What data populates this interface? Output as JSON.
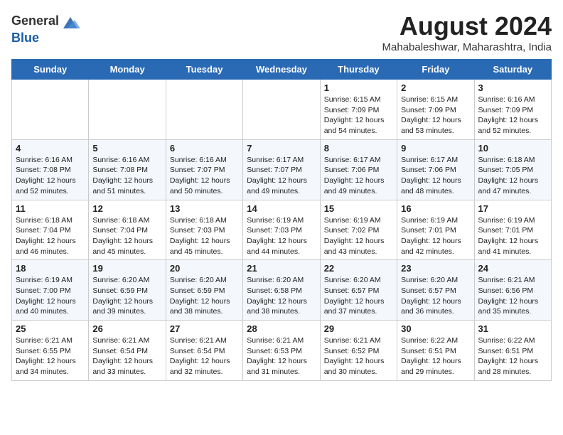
{
  "header": {
    "logo_general": "General",
    "logo_blue": "Blue",
    "month_year": "August 2024",
    "location": "Mahabaleshwar, Maharashtra, India"
  },
  "days_of_week": [
    "Sunday",
    "Monday",
    "Tuesday",
    "Wednesday",
    "Thursday",
    "Friday",
    "Saturday"
  ],
  "weeks": [
    [
      {
        "day": "",
        "sunrise": "",
        "sunset": "",
        "daylight": ""
      },
      {
        "day": "",
        "sunrise": "",
        "sunset": "",
        "daylight": ""
      },
      {
        "day": "",
        "sunrise": "",
        "sunset": "",
        "daylight": ""
      },
      {
        "day": "",
        "sunrise": "",
        "sunset": "",
        "daylight": ""
      },
      {
        "day": "1",
        "sunrise": "Sunrise: 6:15 AM",
        "sunset": "Sunset: 7:09 PM",
        "daylight": "Daylight: 12 hours and 54 minutes."
      },
      {
        "day": "2",
        "sunrise": "Sunrise: 6:15 AM",
        "sunset": "Sunset: 7:09 PM",
        "daylight": "Daylight: 12 hours and 53 minutes."
      },
      {
        "day": "3",
        "sunrise": "Sunrise: 6:16 AM",
        "sunset": "Sunset: 7:09 PM",
        "daylight": "Daylight: 12 hours and 52 minutes."
      }
    ],
    [
      {
        "day": "4",
        "sunrise": "Sunrise: 6:16 AM",
        "sunset": "Sunset: 7:08 PM",
        "daylight": "Daylight: 12 hours and 52 minutes."
      },
      {
        "day": "5",
        "sunrise": "Sunrise: 6:16 AM",
        "sunset": "Sunset: 7:08 PM",
        "daylight": "Daylight: 12 hours and 51 minutes."
      },
      {
        "day": "6",
        "sunrise": "Sunrise: 6:16 AM",
        "sunset": "Sunset: 7:07 PM",
        "daylight": "Daylight: 12 hours and 50 minutes."
      },
      {
        "day": "7",
        "sunrise": "Sunrise: 6:17 AM",
        "sunset": "Sunset: 7:07 PM",
        "daylight": "Daylight: 12 hours and 49 minutes."
      },
      {
        "day": "8",
        "sunrise": "Sunrise: 6:17 AM",
        "sunset": "Sunset: 7:06 PM",
        "daylight": "Daylight: 12 hours and 49 minutes."
      },
      {
        "day": "9",
        "sunrise": "Sunrise: 6:17 AM",
        "sunset": "Sunset: 7:06 PM",
        "daylight": "Daylight: 12 hours and 48 minutes."
      },
      {
        "day": "10",
        "sunrise": "Sunrise: 6:18 AM",
        "sunset": "Sunset: 7:05 PM",
        "daylight": "Daylight: 12 hours and 47 minutes."
      }
    ],
    [
      {
        "day": "11",
        "sunrise": "Sunrise: 6:18 AM",
        "sunset": "Sunset: 7:04 PM",
        "daylight": "Daylight: 12 hours and 46 minutes."
      },
      {
        "day": "12",
        "sunrise": "Sunrise: 6:18 AM",
        "sunset": "Sunset: 7:04 PM",
        "daylight": "Daylight: 12 hours and 45 minutes."
      },
      {
        "day": "13",
        "sunrise": "Sunrise: 6:18 AM",
        "sunset": "Sunset: 7:03 PM",
        "daylight": "Daylight: 12 hours and 45 minutes."
      },
      {
        "day": "14",
        "sunrise": "Sunrise: 6:19 AM",
        "sunset": "Sunset: 7:03 PM",
        "daylight": "Daylight: 12 hours and 44 minutes."
      },
      {
        "day": "15",
        "sunrise": "Sunrise: 6:19 AM",
        "sunset": "Sunset: 7:02 PM",
        "daylight": "Daylight: 12 hours and 43 minutes."
      },
      {
        "day": "16",
        "sunrise": "Sunrise: 6:19 AM",
        "sunset": "Sunset: 7:01 PM",
        "daylight": "Daylight: 12 hours and 42 minutes."
      },
      {
        "day": "17",
        "sunrise": "Sunrise: 6:19 AM",
        "sunset": "Sunset: 7:01 PM",
        "daylight": "Daylight: 12 hours and 41 minutes."
      }
    ],
    [
      {
        "day": "18",
        "sunrise": "Sunrise: 6:19 AM",
        "sunset": "Sunset: 7:00 PM",
        "daylight": "Daylight: 12 hours and 40 minutes."
      },
      {
        "day": "19",
        "sunrise": "Sunrise: 6:20 AM",
        "sunset": "Sunset: 6:59 PM",
        "daylight": "Daylight: 12 hours and 39 minutes."
      },
      {
        "day": "20",
        "sunrise": "Sunrise: 6:20 AM",
        "sunset": "Sunset: 6:59 PM",
        "daylight": "Daylight: 12 hours and 38 minutes."
      },
      {
        "day": "21",
        "sunrise": "Sunrise: 6:20 AM",
        "sunset": "Sunset: 6:58 PM",
        "daylight": "Daylight: 12 hours and 38 minutes."
      },
      {
        "day": "22",
        "sunrise": "Sunrise: 6:20 AM",
        "sunset": "Sunset: 6:57 PM",
        "daylight": "Daylight: 12 hours and 37 minutes."
      },
      {
        "day": "23",
        "sunrise": "Sunrise: 6:20 AM",
        "sunset": "Sunset: 6:57 PM",
        "daylight": "Daylight: 12 hours and 36 minutes."
      },
      {
        "day": "24",
        "sunrise": "Sunrise: 6:21 AM",
        "sunset": "Sunset: 6:56 PM",
        "daylight": "Daylight: 12 hours and 35 minutes."
      }
    ],
    [
      {
        "day": "25",
        "sunrise": "Sunrise: 6:21 AM",
        "sunset": "Sunset: 6:55 PM",
        "daylight": "Daylight: 12 hours and 34 minutes."
      },
      {
        "day": "26",
        "sunrise": "Sunrise: 6:21 AM",
        "sunset": "Sunset: 6:54 PM",
        "daylight": "Daylight: 12 hours and 33 minutes."
      },
      {
        "day": "27",
        "sunrise": "Sunrise: 6:21 AM",
        "sunset": "Sunset: 6:54 PM",
        "daylight": "Daylight: 12 hours and 32 minutes."
      },
      {
        "day": "28",
        "sunrise": "Sunrise: 6:21 AM",
        "sunset": "Sunset: 6:53 PM",
        "daylight": "Daylight: 12 hours and 31 minutes."
      },
      {
        "day": "29",
        "sunrise": "Sunrise: 6:21 AM",
        "sunset": "Sunset: 6:52 PM",
        "daylight": "Daylight: 12 hours and 30 minutes."
      },
      {
        "day": "30",
        "sunrise": "Sunrise: 6:22 AM",
        "sunset": "Sunset: 6:51 PM",
        "daylight": "Daylight: 12 hours and 29 minutes."
      },
      {
        "day": "31",
        "sunrise": "Sunrise: 6:22 AM",
        "sunset": "Sunset: 6:51 PM",
        "daylight": "Daylight: 12 hours and 28 minutes."
      }
    ]
  ]
}
